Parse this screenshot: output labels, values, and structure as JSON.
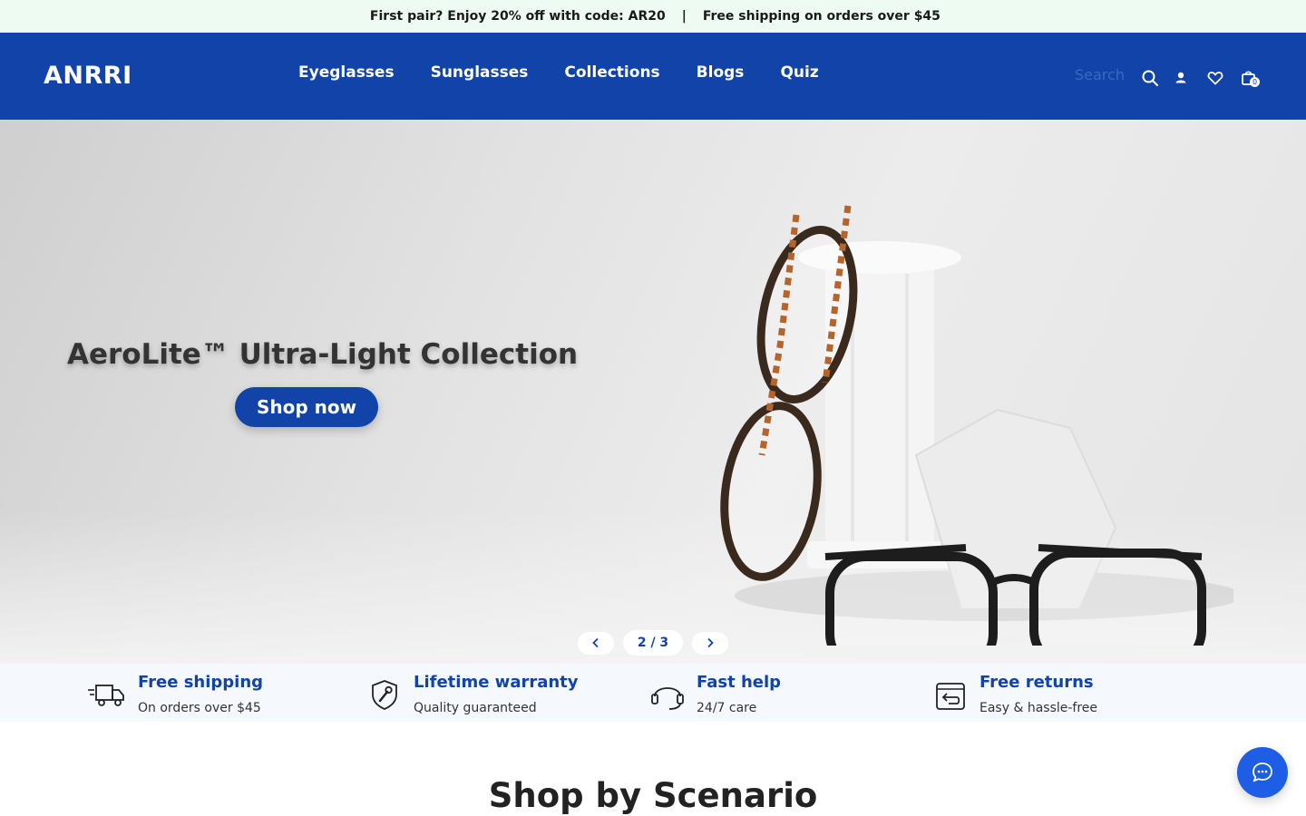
{
  "announcement": {
    "promo": "​ First pair? Enjoy 20% off with code: AR20",
    "separator": "|",
    "shipping": "Free shipping on orders over $45"
  },
  "header": {
    "logo": "ANRRI",
    "nav": [
      "Eyeglasses",
      "Sunglasses",
      "Collections",
      "Blogs",
      "Quiz"
    ],
    "search_placeholder": "Search",
    "cart_count": "0",
    "colors": {
      "brand": "#1143a8"
    }
  },
  "hero": {
    "title": "AeroLite™ Ultra-Light Collection",
    "cta": "Shop now",
    "pager": "2 / 3"
  },
  "features": [
    {
      "icon": "truck-icon",
      "title": "Free shipping",
      "subtitle": "On orders over $45"
    },
    {
      "icon": "shield-wrench-icon",
      "title": "Lifetime warranty",
      "subtitle": "Quality guaranteed"
    },
    {
      "icon": "headset-icon",
      "title": "Fast help",
      "subtitle": "24/7 care"
    },
    {
      "icon": "return-box-icon",
      "title": "Free returns",
      "subtitle": "Easy & hassle-free"
    }
  ],
  "section": {
    "title": "Shop by Scenario"
  },
  "chat": {
    "icon": "chat-bubble-icon"
  }
}
